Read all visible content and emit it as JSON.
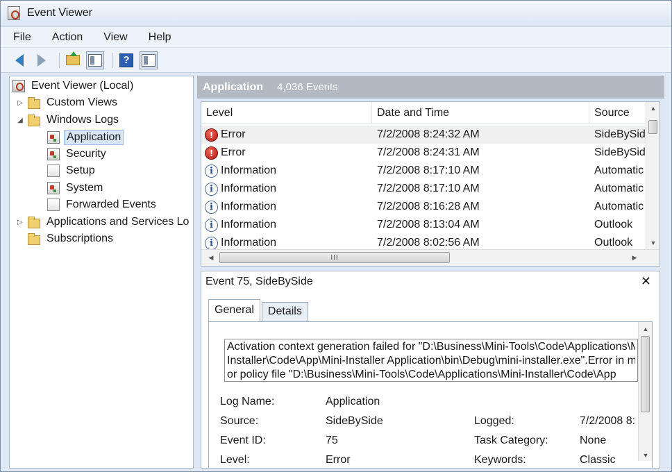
{
  "window": {
    "title": "Event Viewer"
  },
  "menu": {
    "items": [
      "File",
      "Action",
      "View",
      "Help"
    ]
  },
  "toolbar": {
    "buttons": [
      {
        "icon": "back-arrow-icon"
      },
      {
        "icon": "forward-arrow-icon"
      },
      {
        "icon": "folder-up-icon"
      },
      {
        "icon": "show-hide-tree-icon"
      },
      {
        "icon": "help-icon",
        "glyph": "?"
      },
      {
        "icon": "show-hide-action-pane-icon"
      }
    ]
  },
  "tree": {
    "root": "Event Viewer (Local)",
    "custom_views": "Custom Views",
    "windows_logs": "Windows Logs",
    "application": "Application",
    "security": "Security",
    "setup": "Setup",
    "system": "System",
    "forwarded_events": "Forwarded Events",
    "apps_services": "Applications and Services Lo",
    "subscriptions": "Subscriptions",
    "expand_glyph": "▷",
    "collapse_glyph": "◢"
  },
  "events": {
    "title": "Application",
    "count": "4,036 Events",
    "columns": {
      "level": "Level",
      "date": "Date and Time",
      "source": "Source"
    },
    "rows": [
      {
        "level": "Error",
        "type": "error",
        "date": "7/2/2008 8:24:32 AM",
        "source": "SideBySide"
      },
      {
        "level": "Error",
        "type": "error",
        "date": "7/2/2008 8:24:31 AM",
        "source": "SideBySide"
      },
      {
        "level": "Information",
        "type": "info",
        "date": "7/2/2008 8:17:10 AM",
        "source": "Automatic"
      },
      {
        "level": "Information",
        "type": "info",
        "date": "7/2/2008 8:17:10 AM",
        "source": "Automatic"
      },
      {
        "level": "Information",
        "type": "info",
        "date": "7/2/2008 8:16:28 AM",
        "source": "Automatic"
      },
      {
        "level": "Information",
        "type": "info",
        "date": "7/2/2008 8:13:04 AM",
        "source": "Outlook"
      },
      {
        "level": "Information",
        "type": "info",
        "date": "7/2/2008 8:02:56 AM",
        "source": "Outlook"
      }
    ],
    "error_glyph": "!",
    "info_glyph": "i",
    "hscroll_grip": "III"
  },
  "detail": {
    "title": "Event 75, SideBySide",
    "close": "✕",
    "tabs": [
      "General",
      "Details"
    ],
    "description": [
      "Activation context generation failed for \"D:\\Business\\Mini-Tools\\Code\\Applications\\Mini-",
      "Installer\\Code\\App\\Mini-Installer Application\\bin\\Debug\\mini-installer.exe\".Error in manifest",
      "or policy file \"D:\\Business\\Mini-Tools\\Code\\Applications\\Mini-Installer\\Code\\App"
    ],
    "labels": {
      "log_name": "Log Name:",
      "source": "Source:",
      "event_id": "Event ID:",
      "level": "Level:",
      "logged": "Logged:",
      "task_category": "Task Category:",
      "keywords": "Keywords:"
    },
    "values": {
      "log_name": "Application",
      "source": "SideBySide",
      "event_id": "75",
      "level": "Error",
      "logged": "7/2/2008 8:",
      "task_category": "None",
      "keywords": "Classic"
    }
  },
  "scroll": {
    "up": "▲",
    "down": "▼",
    "left": "◀",
    "right": "▶"
  }
}
